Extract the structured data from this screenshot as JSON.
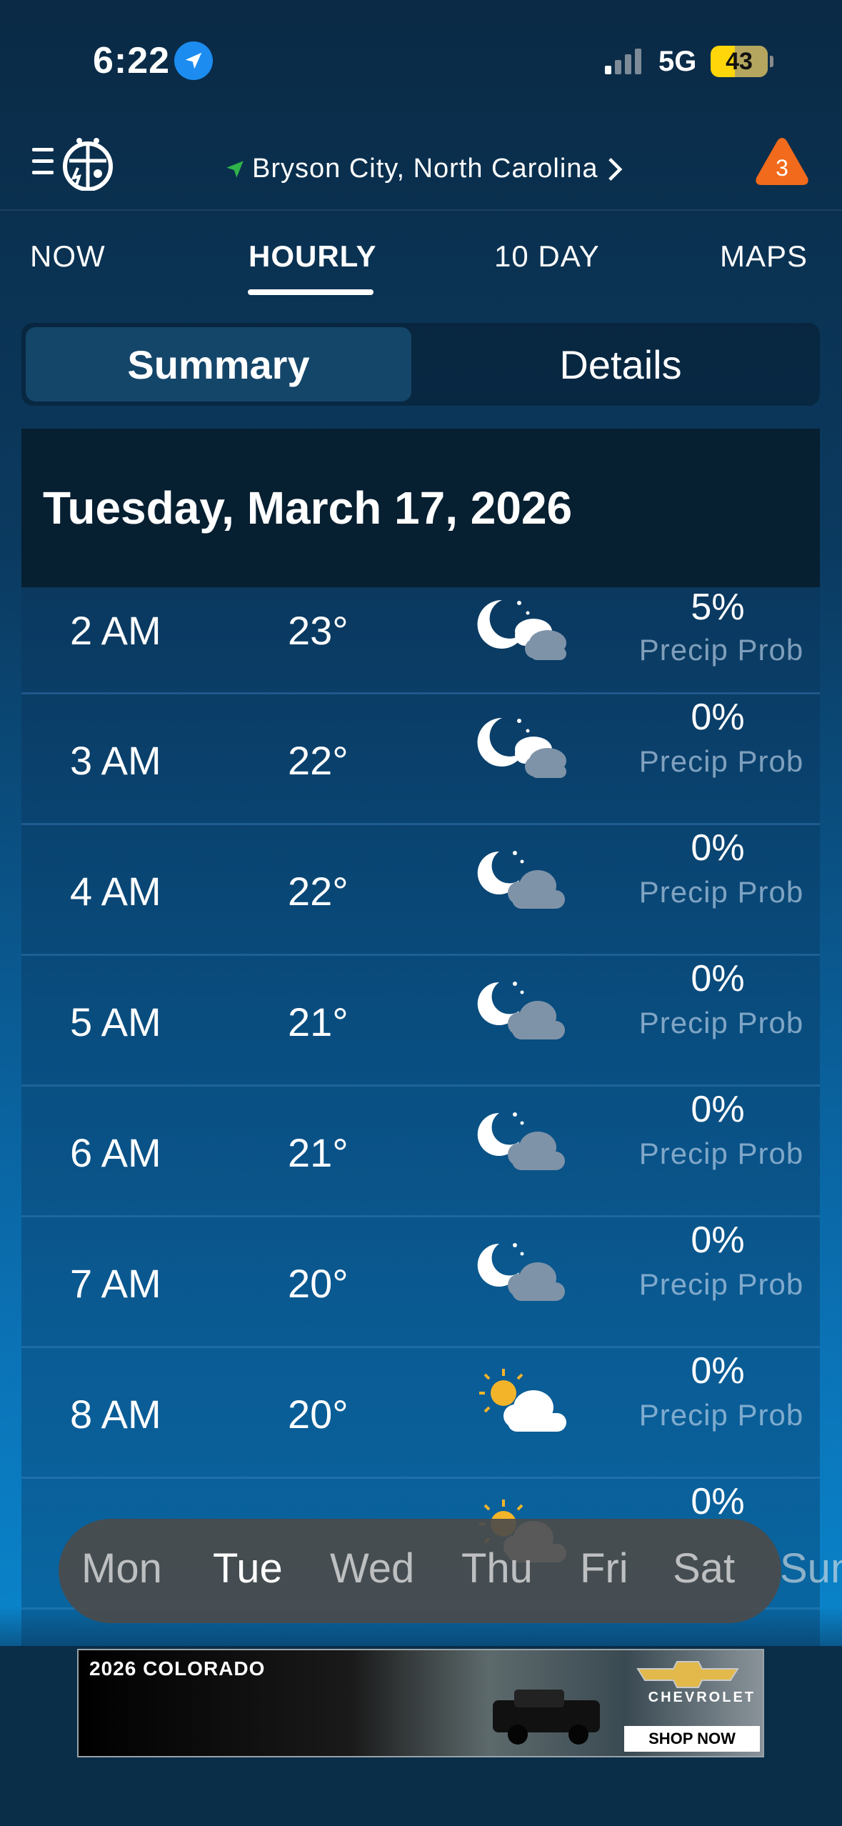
{
  "status_bar": {
    "time": "6:22",
    "network": "5G",
    "battery": "43"
  },
  "header": {
    "location": "Bryson City, North Carolina",
    "alert_count": "3"
  },
  "tabs": [
    {
      "label": "NOW",
      "active": false
    },
    {
      "label": "HOURLY",
      "active": true
    },
    {
      "label": "10 DAY",
      "active": false
    },
    {
      "label": "MAPS",
      "active": false
    }
  ],
  "segment": {
    "summary": "Summary",
    "details": "Details"
  },
  "date_header": "Tuesday, March 17, 2026",
  "hourly": [
    {
      "time": "2 AM",
      "temp": "23°",
      "icon": "night-cloudy-icon",
      "precip": "5%",
      "label": "Precip Prob"
    },
    {
      "time": "3 AM",
      "temp": "22°",
      "icon": "night-cloudy-icon",
      "precip": "0%",
      "label": "Precip Prob"
    },
    {
      "time": "4 AM",
      "temp": "22°",
      "icon": "night-partly-cloudy-icon",
      "precip": "0%",
      "label": "Precip Prob"
    },
    {
      "time": "5 AM",
      "temp": "21°",
      "icon": "night-partly-cloudy-icon",
      "precip": "0%",
      "label": "Precip Prob"
    },
    {
      "time": "6 AM",
      "temp": "21°",
      "icon": "night-partly-cloudy-icon",
      "precip": "0%",
      "label": "Precip Prob"
    },
    {
      "time": "7 AM",
      "temp": "20°",
      "icon": "night-partly-cloudy-icon",
      "precip": "0%",
      "label": "Precip Prob"
    },
    {
      "time": "8 AM",
      "temp": "20°",
      "icon": "sun-cloud-icon",
      "precip": "0%",
      "label": "Precip Prob"
    },
    {
      "time": "",
      "temp": "",
      "icon": "sun-cloud-icon",
      "precip": "0%",
      "label": ""
    }
  ],
  "days": {
    "mon": "Mon",
    "tue": "Tue",
    "wed": "Wed",
    "thu": "Thu",
    "fri": "Fri",
    "sat": "Sat",
    "sun": "Sun"
  },
  "ad": {
    "title": "2026 COLORADO",
    "brand": "CHEVROLET",
    "cta": "SHOP NOW"
  }
}
